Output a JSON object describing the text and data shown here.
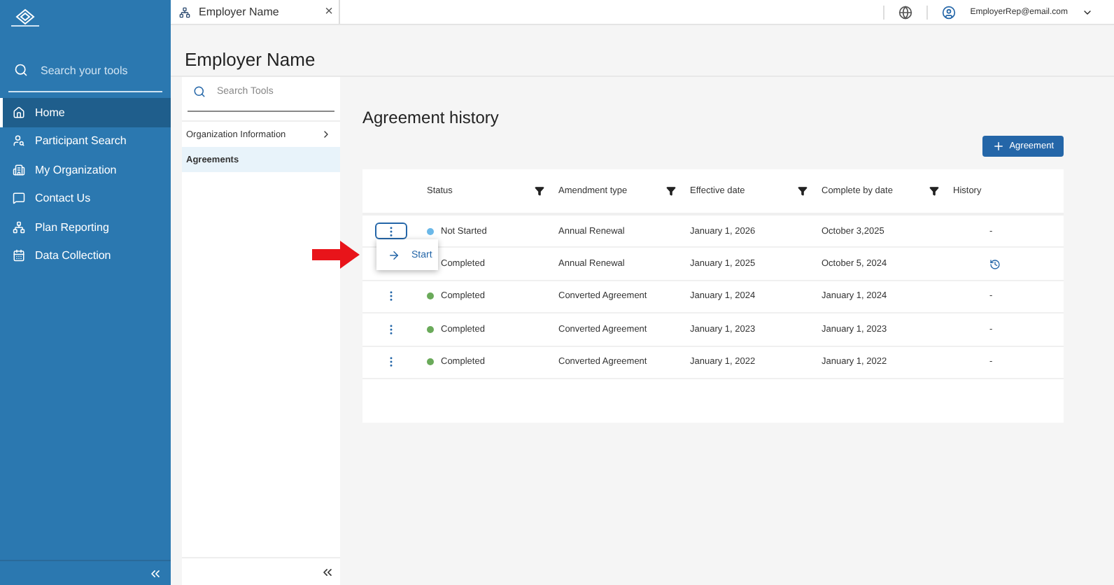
{
  "sidebar": {
    "search": {
      "placeholder": "Search your tools"
    },
    "items": [
      {
        "label": "Home",
        "selected": true
      },
      {
        "label": "Participant Search",
        "selected": false
      },
      {
        "label": "My Organization",
        "selected": false
      },
      {
        "label": "Contact Us",
        "selected": false
      },
      {
        "label": "Plan Reporting",
        "selected": false
      },
      {
        "label": "Data Collection",
        "selected": false
      }
    ]
  },
  "tab": {
    "title": "Employer Name",
    "close": "×"
  },
  "topbar": {
    "user": "EmployerRep@email.com"
  },
  "page_title": "Employer Name",
  "tools": {
    "search": {
      "placeholder": "Search Tools"
    },
    "items": [
      {
        "label": "Organization Information",
        "has_children": true,
        "selected": false
      },
      {
        "label": "Agreements",
        "has_children": false,
        "selected": true
      }
    ]
  },
  "section_title": "Agreement history",
  "add_button": "Agreement",
  "table": {
    "columns": [
      {
        "label": "Status",
        "filter": true
      },
      {
        "label": "Amendment type",
        "filter": true
      },
      {
        "label": "Effective date",
        "filter": true
      },
      {
        "label": "Complete by date",
        "filter": true
      },
      {
        "label": "History",
        "filter": false
      }
    ],
    "rows": [
      {
        "status": "Not Started",
        "color": "#6bb8e8",
        "type": "Annual Renewal",
        "effective": "January 1, 2026",
        "complete": "October 3,2025",
        "history": {
          "kind": "text",
          "text": "-"
        },
        "menu_open": true
      },
      {
        "status": "Completed",
        "type": "Annual Renewal",
        "effective": "January 1, 2025",
        "complete": "October 5, 2024",
        "history": {
          "kind": "icon"
        },
        "menu_open": false
      },
      {
        "status": "Completed",
        "color": "#6aaa5a",
        "type": "Converted Agreement",
        "effective": "January 1, 2024",
        "complete": "January 1, 2024",
        "history": {
          "kind": "text",
          "text": "-"
        },
        "menu_open": false
      },
      {
        "status": "Completed",
        "color": "#6aaa5a",
        "type": "Converted Agreement",
        "effective": "January 1, 2023",
        "complete": "January 1, 2023",
        "history": {
          "kind": "text",
          "text": "-"
        },
        "menu_open": false
      },
      {
        "status": "Completed",
        "color": "#6aaa5a",
        "type": "Converted Agreement",
        "effective": "January 1, 2022",
        "complete": "January 1, 2022",
        "history": {
          "kind": "text",
          "text": "-"
        },
        "menu_open": false
      }
    ]
  },
  "row_menu": {
    "items": [
      {
        "label": "Start"
      }
    ]
  }
}
